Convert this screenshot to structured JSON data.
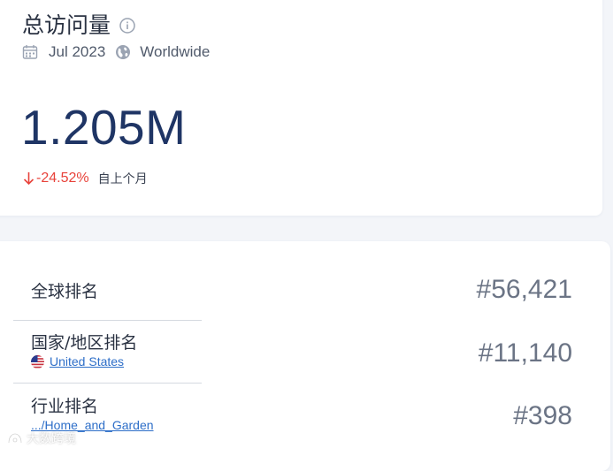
{
  "visits_card": {
    "title": "总访问量",
    "date": "Jul 2023",
    "region": "Worldwide",
    "total_visits": "1.205M",
    "change": "-24.52%",
    "change_period": "自上个月",
    "accent_color": "#1f3565",
    "negative_color": "#e8423a",
    "icons": [
      "info-icon",
      "calendar-icon",
      "globe-icon",
      "arrow-down-icon"
    ]
  },
  "ranks_card": {
    "global": {
      "label": "全球排名",
      "value": "#56,421"
    },
    "country": {
      "label": "国家/地区排名",
      "sub_label": "United States",
      "value": "#11,140",
      "icon": "us-flag-icon"
    },
    "category": {
      "label": "行业排名",
      "sub_label": ".../Home_and_Garden",
      "value": "#398"
    },
    "link_color": "#2d6ec8"
  },
  "watermark": {
    "text": "大数跨境"
  }
}
